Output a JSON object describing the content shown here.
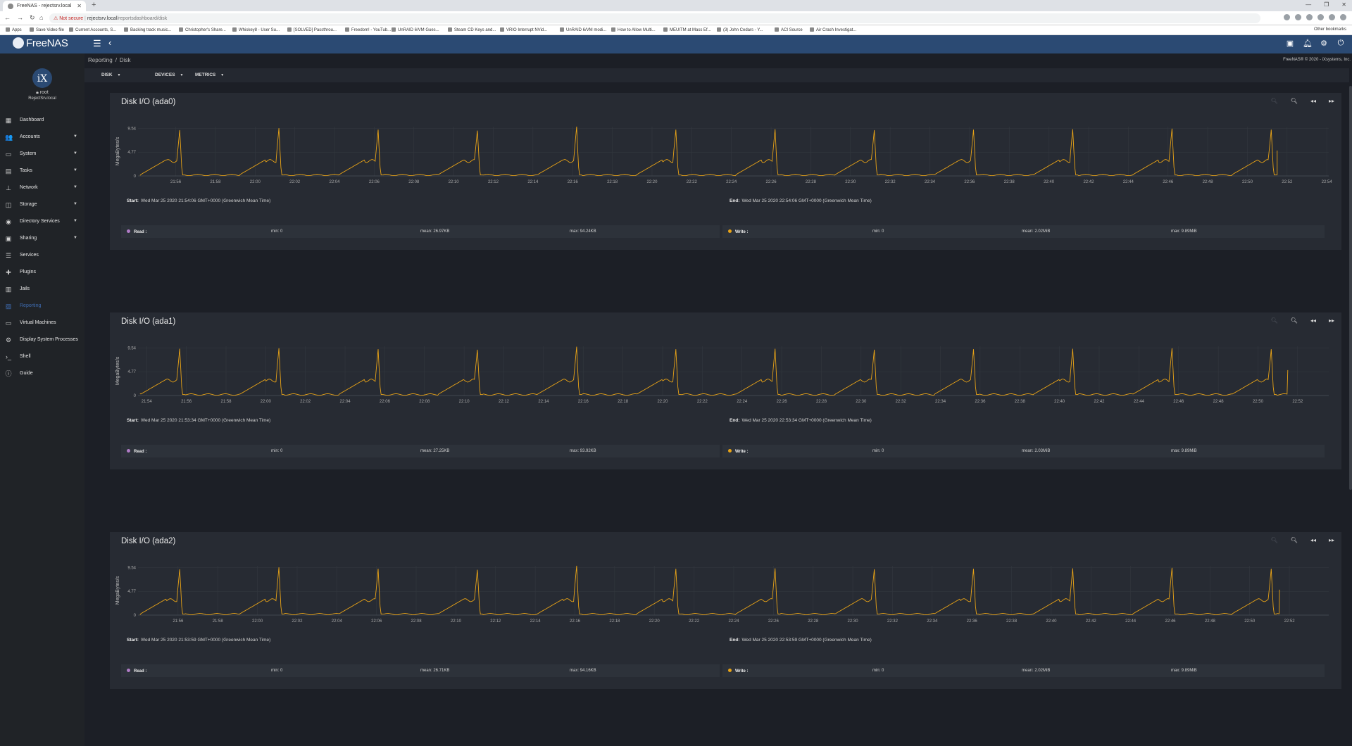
{
  "browser": {
    "tab_title": "FreeNAS - rejectsrv.local",
    "url_warning": "Not secure",
    "url_host": "rejectsrv.local",
    "url_path": "/reportsdashboard/disk",
    "bookmarks": [
      "Apps",
      "Save Video file",
      "Current Accounts, S...",
      "Backing track music...",
      "Christopher's Share...",
      "Whiskey8 - User Su...",
      "[SOLVED] Passthrou...",
      "Freedom! - YouTub...",
      "UnRAID 6/VM Gues...",
      "Steam CD Keys and...",
      "VRIO Interrupt NVid...",
      "UnRAID 6/VM modi...",
      "How to Allow Multi...",
      "MEUITM at Mass Ef...",
      "(3) John Cedars - Y...",
      "ACI Source",
      "Air Crash Investigat..."
    ],
    "other_bookmarks": "Other bookmarks"
  },
  "topbar": {
    "logo_text": "FreeNAS"
  },
  "sidebar": {
    "user": "root",
    "host": "RejectSrv.local",
    "items": [
      {
        "label": "Dashboard",
        "icon": "dashboard-icon",
        "glyph": "▦",
        "arrow": false
      },
      {
        "label": "Accounts",
        "icon": "accounts-icon",
        "glyph": "👥",
        "arrow": true
      },
      {
        "label": "System",
        "icon": "system-icon",
        "glyph": "▭",
        "arrow": true
      },
      {
        "label": "Tasks",
        "icon": "tasks-icon",
        "glyph": "▤",
        "arrow": true
      },
      {
        "label": "Network",
        "icon": "network-icon",
        "glyph": "⊥",
        "arrow": true
      },
      {
        "label": "Storage",
        "icon": "storage-icon",
        "glyph": "◫",
        "arrow": true
      },
      {
        "label": "Directory Services",
        "icon": "directory-services-icon",
        "glyph": "◉",
        "arrow": true
      },
      {
        "label": "Sharing",
        "icon": "sharing-icon",
        "glyph": "▣",
        "arrow": true
      },
      {
        "label": "Services",
        "icon": "services-icon",
        "glyph": "☰",
        "arrow": false
      },
      {
        "label": "Plugins",
        "icon": "plugins-icon",
        "glyph": "✚",
        "arrow": false
      },
      {
        "label": "Jails",
        "icon": "jails-icon",
        "glyph": "▥",
        "arrow": false
      },
      {
        "label": "Reporting",
        "icon": "reporting-icon",
        "glyph": "▨",
        "arrow": false,
        "active": true
      },
      {
        "label": "Virtual Machines",
        "icon": "virtual-machines-icon",
        "glyph": "▭",
        "arrow": false
      },
      {
        "label": "Display System Processes",
        "icon": "processes-icon",
        "glyph": "⚙",
        "arrow": false
      },
      {
        "label": "Shell",
        "icon": "shell-icon",
        "glyph": "›_",
        "arrow": false
      },
      {
        "label": "Guide",
        "icon": "guide-icon",
        "glyph": "ⓘ",
        "arrow": false
      }
    ]
  },
  "main": {
    "breadcrumb": [
      "Reporting",
      "Disk"
    ],
    "copyright": "FreeNAS® © 2020 - iXsystems, Inc.",
    "toolbar": {
      "disk": "DISK",
      "devices": "DEVICES",
      "metrics": "METRICS"
    }
  },
  "colors": {
    "read": "#b07cc6",
    "write": "#e8a317",
    "line": "#e8a317",
    "accent": "#2b4a73"
  },
  "chart_data": [
    {
      "type": "line",
      "title": "Disk I/O (ada0)",
      "ylabel": "MegaBytes/s",
      "yticks": [
        "9.54",
        "4.77",
        "0"
      ],
      "ylim": [
        0,
        9.89
      ],
      "x_ticks": [
        "21:56",
        "21:58",
        "22:00",
        "22:02",
        "22:04",
        "22:06",
        "22:08",
        "22:10",
        "22:12",
        "22:14",
        "22:16",
        "22:18",
        "22:20",
        "22:22",
        "22:24",
        "22:26",
        "22:28",
        "22:30",
        "22:32",
        "22:34",
        "22:36",
        "22:38",
        "22:40",
        "22:42",
        "22:44",
        "22:46",
        "22:48",
        "22:50",
        "22:52",
        "22:54"
      ],
      "x_start": "21:54:06",
      "x_end": "22:54:06",
      "data_end": "22:51:30",
      "period_minutes": 5,
      "baseline": 0.2,
      "plateau": 3.0,
      "peaks": [
        9.2,
        9.6,
        9.3,
        9.1,
        9.9,
        9.3,
        9.4,
        9.2,
        9.3,
        9.4,
        9.5,
        9.3
      ],
      "start_label": "Start:",
      "start": "Wed Mar 25 2020 21:54:06 GMT+0000 (Greenwich Mean Time)",
      "end_label": "End:",
      "end": "Wed Mar 25 2020 22:54:06 GMT+0000 (Greenwich Mean Time)",
      "read": {
        "name": "Read :",
        "min": "min: 0",
        "mean": "mean: 26.97KB",
        "max": "max: 94.24KB"
      },
      "write": {
        "name": "Write :",
        "min": "min: 0",
        "mean": "mean: 2.02MiB",
        "max": "max: 9.89MiB"
      }
    },
    {
      "type": "line",
      "title": "Disk I/O (ada1)",
      "ylabel": "MegaBytes/s",
      "yticks": [
        "9.54",
        "4.77",
        "0"
      ],
      "ylim": [
        0,
        9.89
      ],
      "x_ticks": [
        "21:54",
        "21:56",
        "21:58",
        "22:00",
        "22:02",
        "22:04",
        "22:06",
        "22:08",
        "22:10",
        "22:12",
        "22:14",
        "22:16",
        "22:18",
        "22:20",
        "22:22",
        "22:24",
        "22:26",
        "22:28",
        "22:30",
        "22:32",
        "22:34",
        "22:36",
        "22:38",
        "22:40",
        "22:42",
        "22:44",
        "22:46",
        "22:48",
        "22:50",
        "22:52"
      ],
      "x_start": "21:53:34",
      "x_end": "22:53:34",
      "data_end": "22:51:30",
      "period_minutes": 5,
      "baseline": 0.2,
      "plateau": 3.0,
      "peaks": [
        9.4,
        9.5,
        9.3,
        9.2,
        9.8,
        9.3,
        9.4,
        9.2,
        9.3,
        9.4,
        9.5,
        9.3
      ],
      "start_label": "Start:",
      "start": "Wed Mar 25 2020 21:53:34 GMT+0000 (Greenwich Mean Time)",
      "end_label": "End:",
      "end": "Wed Mar 25 2020 22:53:34 GMT+0000 (Greenwich Mean Time)",
      "read": {
        "name": "Read :",
        "min": "min: 0",
        "mean": "mean: 27.25KB",
        "max": "max: 93.92KB"
      },
      "write": {
        "name": "Write :",
        "min": "min: 0",
        "mean": "mean: 2.03MiB",
        "max": "max: 9.89MiB"
      }
    },
    {
      "type": "line",
      "title": "Disk I/O (ada2)",
      "ylabel": "MegaBytes/s",
      "yticks": [
        "9.54",
        "4.77",
        "0"
      ],
      "ylim": [
        0,
        9.89
      ],
      "x_ticks": [
        "21:56",
        "21:58",
        "22:00",
        "22:02",
        "22:04",
        "22:06",
        "22:08",
        "22:10",
        "22:12",
        "22:14",
        "22:16",
        "22:18",
        "22:20",
        "22:22",
        "22:24",
        "22:26",
        "22:28",
        "22:30",
        "22:32",
        "22:34",
        "22:36",
        "22:38",
        "22:40",
        "22:42",
        "22:44",
        "22:46",
        "22:48",
        "22:50",
        "22:52"
      ],
      "x_start": "21:53:59",
      "x_end": "22:53:59",
      "data_end": "22:51:30",
      "period_minutes": 5,
      "baseline": 0.2,
      "plateau": 3.0,
      "peaks": [
        9.2,
        9.6,
        9.3,
        9.1,
        9.9,
        9.3,
        9.4,
        9.2,
        9.3,
        9.4,
        9.5,
        9.3
      ],
      "start_label": "Start:",
      "start": "Wed Mar 25 2020 21:53:59 GMT+0000 (Greenwich Mean Time)",
      "end_label": "End:",
      "end": "Wed Mar 25 2020 22:53:59 GMT+0000 (Greenwich Mean Time)",
      "read": {
        "name": "Read :",
        "min": "min: 0",
        "mean": "mean: 26.71KB",
        "max": "max: 94.16KB"
      },
      "write": {
        "name": "Write :",
        "min": "min: 0",
        "mean": "mean: 2.02MiB",
        "max": "max: 9.89MiB"
      }
    }
  ]
}
